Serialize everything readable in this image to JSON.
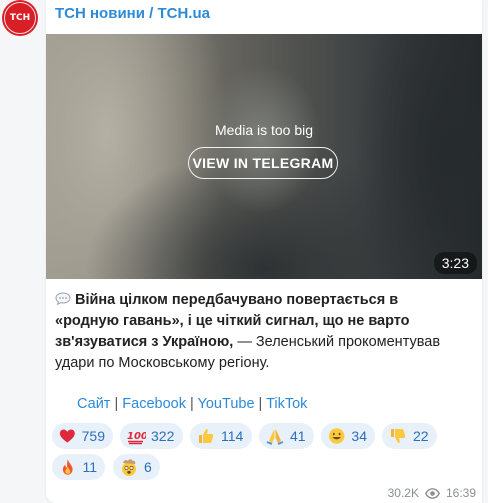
{
  "channel": {
    "avatar_text": "ТСН",
    "name": "ТСН новини / TCH.ua",
    "brand_color": "#d81f26",
    "link_color": "#2d8ad6"
  },
  "media": {
    "message": "Media is too big",
    "button_label": "VIEW IN TELEGRAM",
    "duration": "3:23"
  },
  "post": {
    "bold_text": "Війна цілком передбачувано повертається в «родную гавань», і це чіткий сигнал, що не варто зв'язуватися з Україною,",
    "regular_text": " — Зеленський прокоментував удари по Московському регіону.",
    "leading_icon": "speech-bubble-icon"
  },
  "links": {
    "items": [
      "Сайт",
      "Facebook",
      "YouTube",
      "TikTok"
    ],
    "separator": " | "
  },
  "reactions": [
    {
      "icon": "heart-icon",
      "count": "759"
    },
    {
      "icon": "hundred-points-icon",
      "count": "322"
    },
    {
      "icon": "thumbs-up-icon",
      "count": "114"
    },
    {
      "icon": "folded-hands-icon",
      "count": "41"
    },
    {
      "icon": "grinning-face-icon",
      "count": "34"
    },
    {
      "icon": "thumbs-down-icon",
      "count": "22"
    },
    {
      "icon": "fire-icon",
      "count": "11"
    },
    {
      "icon": "exploding-head-icon",
      "count": "6"
    }
  ],
  "footer": {
    "views": "30.2K",
    "time": "16:39"
  }
}
